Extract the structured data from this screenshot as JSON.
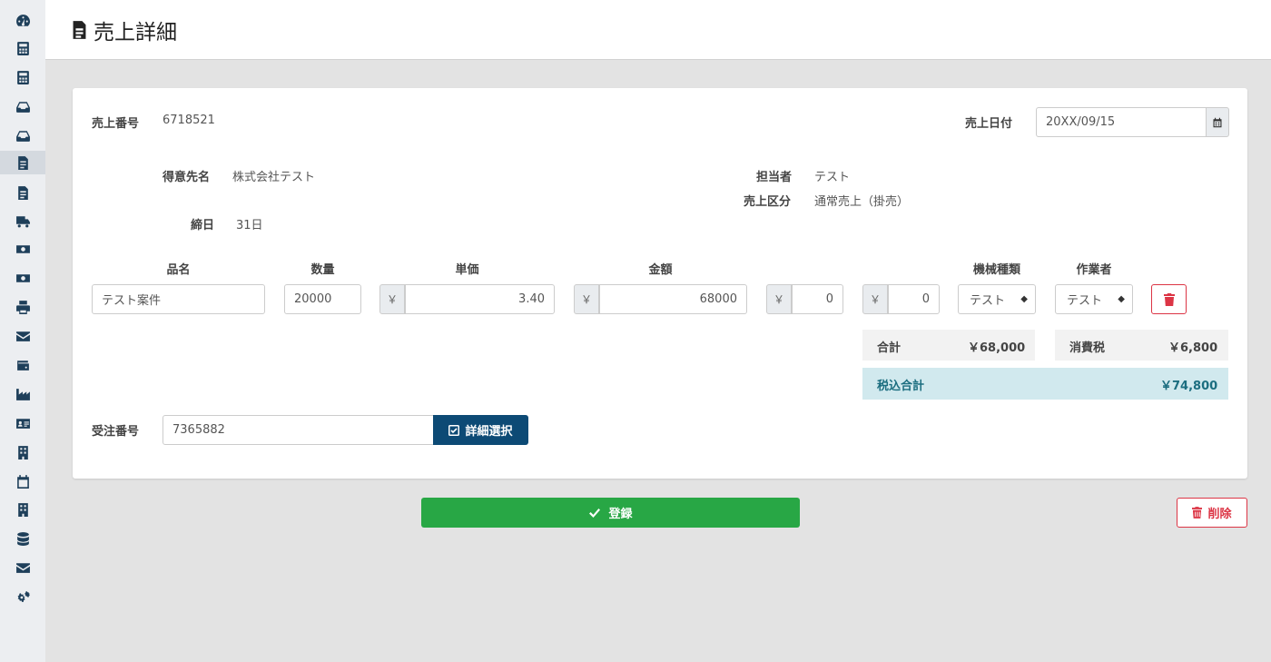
{
  "sidebar": {
    "items": [
      {
        "icon": "tachometer-icon"
      },
      {
        "icon": "calculator-icon"
      },
      {
        "icon": "calculator-icon"
      },
      {
        "icon": "inbox-icon"
      },
      {
        "icon": "inbox-icon"
      },
      {
        "icon": "file-invoice-icon",
        "active": true
      },
      {
        "icon": "file-invoice-icon"
      },
      {
        "icon": "truck-icon"
      },
      {
        "icon": "money-bill-icon"
      },
      {
        "icon": "money-bill-icon"
      },
      {
        "icon": "print-icon"
      },
      {
        "icon": "envelope-icon"
      },
      {
        "icon": "wallet-icon"
      },
      {
        "icon": "industry-icon"
      },
      {
        "icon": "id-card-icon"
      },
      {
        "icon": "building-icon"
      },
      {
        "icon": "calendar-icon"
      },
      {
        "icon": "building-icon"
      },
      {
        "icon": "database-icon"
      },
      {
        "icon": "envelope-icon"
      },
      {
        "icon": "cogs-icon"
      }
    ]
  },
  "header": {
    "title": "売上詳細",
    "icon": "file-invoice-icon"
  },
  "form": {
    "sales_no_label": "売上番号",
    "sales_no": "6718521",
    "sales_date_label": "売上日付",
    "sales_date": "20XX/09/15",
    "customer_label": "得意先名",
    "customer": "株式会社テスト",
    "staff_label": "担当者",
    "staff": "テスト",
    "sales_type_label": "売上区分",
    "sales_type": "通常売上（掛売）",
    "closing_label": "締日",
    "closing": "31日"
  },
  "line": {
    "headers": {
      "item": "品名",
      "qty": "数量",
      "unit_price": "単価",
      "amount": "金額",
      "machine_type": "機械種類",
      "worker": "作業者"
    },
    "currency": "￥",
    "item": "テスト案件",
    "qty": "20000",
    "unit_price": "3.40",
    "amount": "68000",
    "extra1": "0",
    "extra2": "0",
    "machine_type": "テスト",
    "worker": "テスト"
  },
  "totals": {
    "subtotal_label": "合計",
    "subtotal": "￥68,000",
    "tax_label": "消費税",
    "tax": "￥6,800",
    "total_label": "税込合計",
    "total": "￥74,800"
  },
  "order": {
    "label": "受注番号",
    "value": "7365882",
    "detail_button": "詳細選択"
  },
  "actions": {
    "submit": "登録",
    "delete": "削除"
  },
  "colors": {
    "primary": "#0d4a75",
    "success": "#28a745",
    "danger": "#dc3545",
    "tax_bg": "#d1e9ee"
  }
}
